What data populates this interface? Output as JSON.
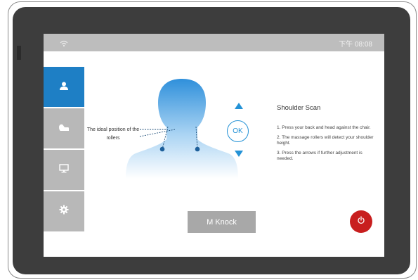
{
  "status_bar": {
    "time": "下午 08:08",
    "wifi_icon": "wifi-icon"
  },
  "sidebar": {
    "items": [
      {
        "icon": "user-icon",
        "active": true
      },
      {
        "icon": "massage-chair-icon",
        "active": false
      },
      {
        "icon": "monitor-icon",
        "active": false
      },
      {
        "icon": "gear-icon",
        "active": false
      }
    ]
  },
  "illustration": {
    "roller_label": "The ideal position of the rollers"
  },
  "controls": {
    "ok_label": "OK",
    "up_icon": "arrow-up-icon",
    "down_icon": "arrow-down-icon"
  },
  "instructions": {
    "title": "Shoulder Scan",
    "steps": [
      "1. Press your back and head against the chair.",
      "2. The massage rollers will detect your shoulder height.",
      "3. Press the arrows if further adjustment is needed."
    ]
  },
  "actions": {
    "mode_label": "M Knock",
    "power_icon": "power-icon"
  },
  "colors": {
    "accent": "#1e7fc5",
    "power": "#c81e1e",
    "nav_inactive": "#b8b8b8",
    "bezel": "#3d3d3d"
  }
}
